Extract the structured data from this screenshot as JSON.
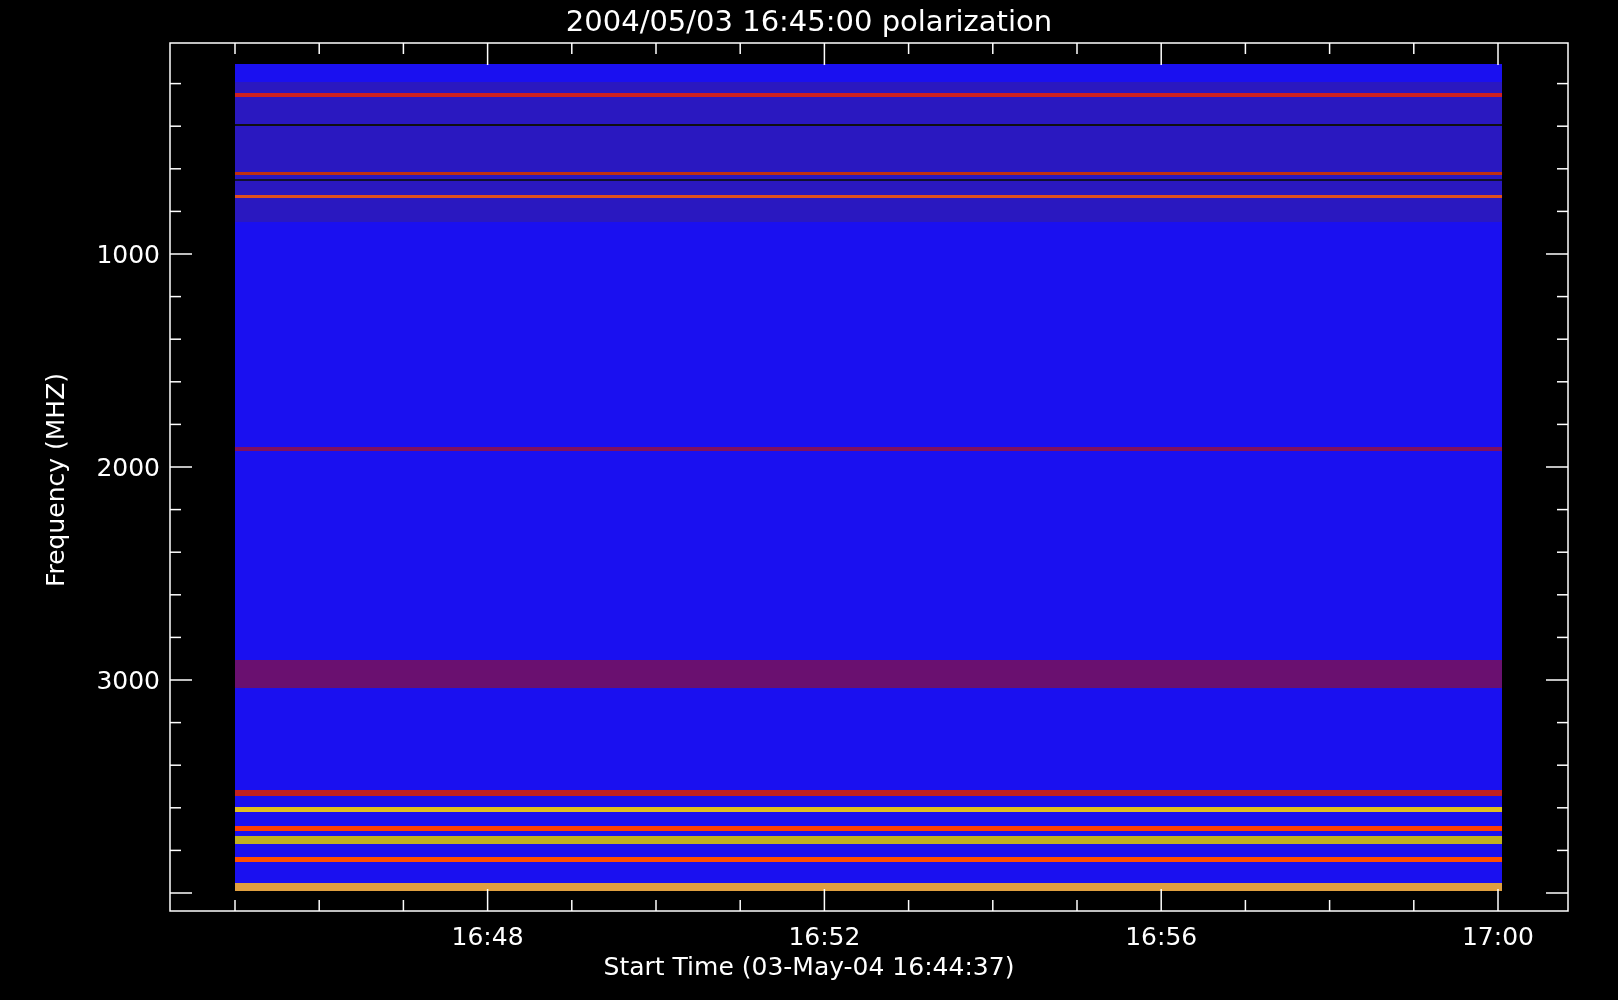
{
  "plot": {
    "title": "2004/05/03 16:45:00 polarization",
    "ylabel": "Frequency (MHZ)",
    "xlabel": "Start Time (03-May-04 16:44:37)",
    "yticks": [
      "1000",
      "2000",
      "3000"
    ],
    "xticks": [
      "16:48",
      "16:52",
      "16:56",
      "17:00"
    ],
    "image": {
      "kind": "picture"
    }
  }
}
